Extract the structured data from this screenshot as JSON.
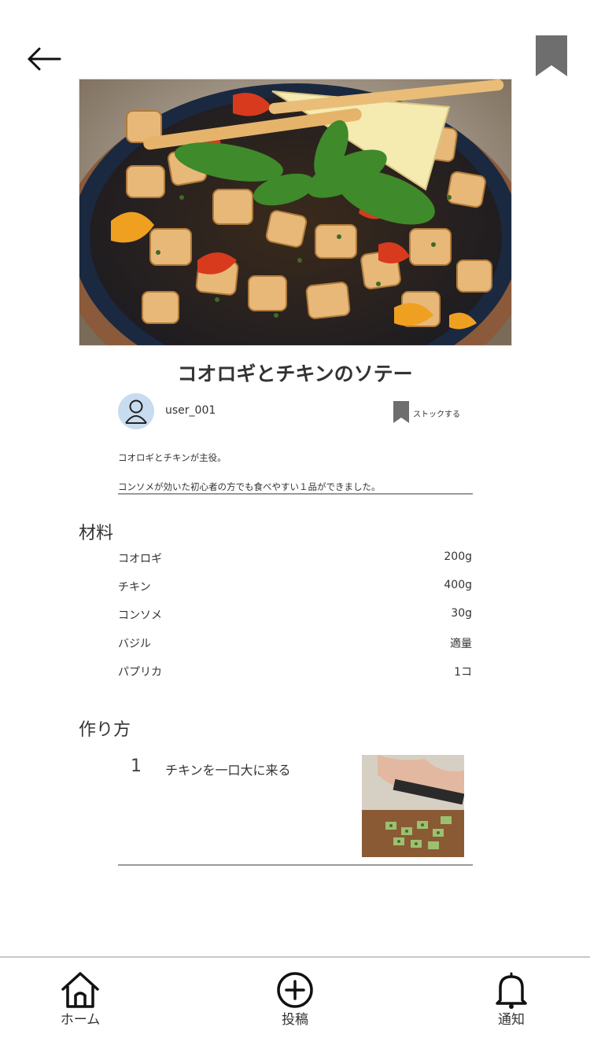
{
  "header": {
    "back_icon": "arrow-left-icon",
    "bookmark_icon": "bookmark-icon"
  },
  "recipe": {
    "title": "コオロギとチキンのソテー",
    "author": "user_001",
    "stock_label": "ストックする",
    "description": [
      "コオロギとチキンが主役。",
      "コンソメが効いた初心者の方でも食べやすい１品ができました。"
    ]
  },
  "ingredients": {
    "heading": "材料",
    "items": [
      {
        "name": "コオロギ",
        "qty": "200g"
      },
      {
        "name": "チキン",
        "qty": "400g"
      },
      {
        "name": "コンソメ",
        "qty": "30g"
      },
      {
        "name": "バジル",
        "qty": "適量"
      },
      {
        "name": "パプリカ",
        "qty": "1コ"
      }
    ]
  },
  "steps": {
    "heading": "作り方",
    "items": [
      {
        "number": "1",
        "text": "チキンを一口大に来る"
      }
    ]
  },
  "nav": {
    "home": {
      "label": "ホーム",
      "icon": "home-icon"
    },
    "post": {
      "label": "投稿",
      "icon": "plus-circle-icon"
    },
    "notify": {
      "label": "通知",
      "icon": "bell-icon"
    }
  },
  "colors": {
    "bookmark": "#6e6e6e",
    "avatar_bg": "#c8dcf0",
    "rule": "#9a9a9a"
  }
}
